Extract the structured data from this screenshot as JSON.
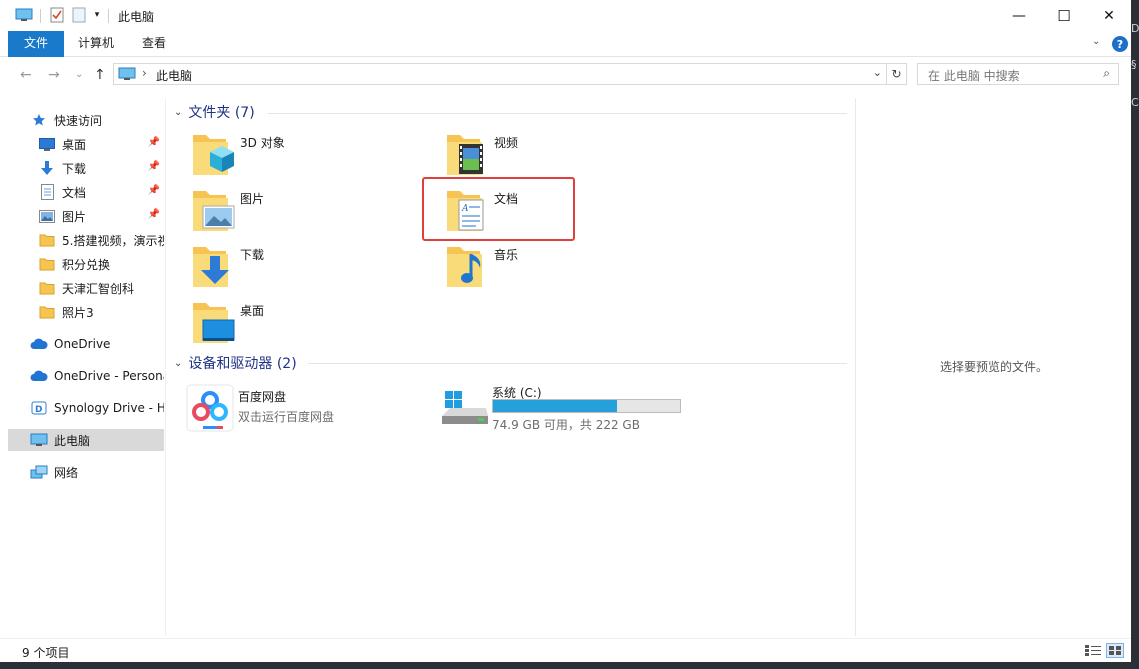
{
  "window": {
    "title": "此电脑",
    "minimize": "—",
    "maximize": "☐",
    "close": "✕"
  },
  "ribbon": {
    "tabs": [
      "文件",
      "计算机",
      "查看"
    ],
    "expand": "⌄",
    "help": "?"
  },
  "nav": {
    "back": "←",
    "forward": "→",
    "recent": "⌄",
    "up": "↑",
    "address_sep": "›",
    "address": "此电脑",
    "address_dropdown": "⌄",
    "refresh": "↻",
    "search_placeholder": "在 此电脑 中搜索",
    "search_icon": "⌕"
  },
  "sidebar": {
    "items": [
      {
        "label": "快速访问",
        "icon": "star-icon",
        "pinned": false
      },
      {
        "label": "桌面",
        "icon": "desktop-icon",
        "pinned": true
      },
      {
        "label": "下载",
        "icon": "download-icon",
        "pinned": true
      },
      {
        "label": "文档",
        "icon": "document-icon",
        "pinned": true
      },
      {
        "label": "图片",
        "icon": "pictures-icon",
        "pinned": true
      },
      {
        "label": "5.搭建视频，演示视",
        "icon": "folder-icon",
        "pinned": false
      },
      {
        "label": "积分兑换",
        "icon": "folder-icon",
        "pinned": false
      },
      {
        "label": "天津汇智创科",
        "icon": "folder-icon",
        "pinned": false
      },
      {
        "label": "照片3",
        "icon": "folder-icon",
        "pinned": false
      },
      {
        "label": "OneDrive",
        "icon": "cloud-icon",
        "pinned": false
      },
      {
        "label": "OneDrive - Persona",
        "icon": "cloud-icon",
        "pinned": false
      },
      {
        "label": "Synology Drive - HI",
        "icon": "synology-icon",
        "pinned": false
      },
      {
        "label": "此电脑",
        "icon": "computer-icon",
        "pinned": false,
        "selected": true
      },
      {
        "label": "网络",
        "icon": "network-icon",
        "pinned": false
      }
    ],
    "pin_glyph": "📌"
  },
  "content": {
    "folders_header": "文件夹 (7)",
    "devices_header": "设备和驱动器 (2)",
    "chevron": "⌄",
    "folders": [
      "3D 对象",
      "视频",
      "图片",
      "文档",
      "下载",
      "音乐",
      "桌面"
    ],
    "devices": [
      {
        "name": "百度网盘",
        "sub": "双击运行百度网盘"
      },
      {
        "name": "系统 (C:)",
        "sub": "74.9 GB 可用，共 222 GB",
        "used_fraction": 0.663
      }
    ]
  },
  "preview": {
    "text": "选择要预览的文件。"
  },
  "status": {
    "count": "9 个项目"
  },
  "colors": {
    "accent": "#1979ca",
    "folder": "#f6c452",
    "drive_fill": "#26a0da",
    "highlight": "#e0403d"
  }
}
